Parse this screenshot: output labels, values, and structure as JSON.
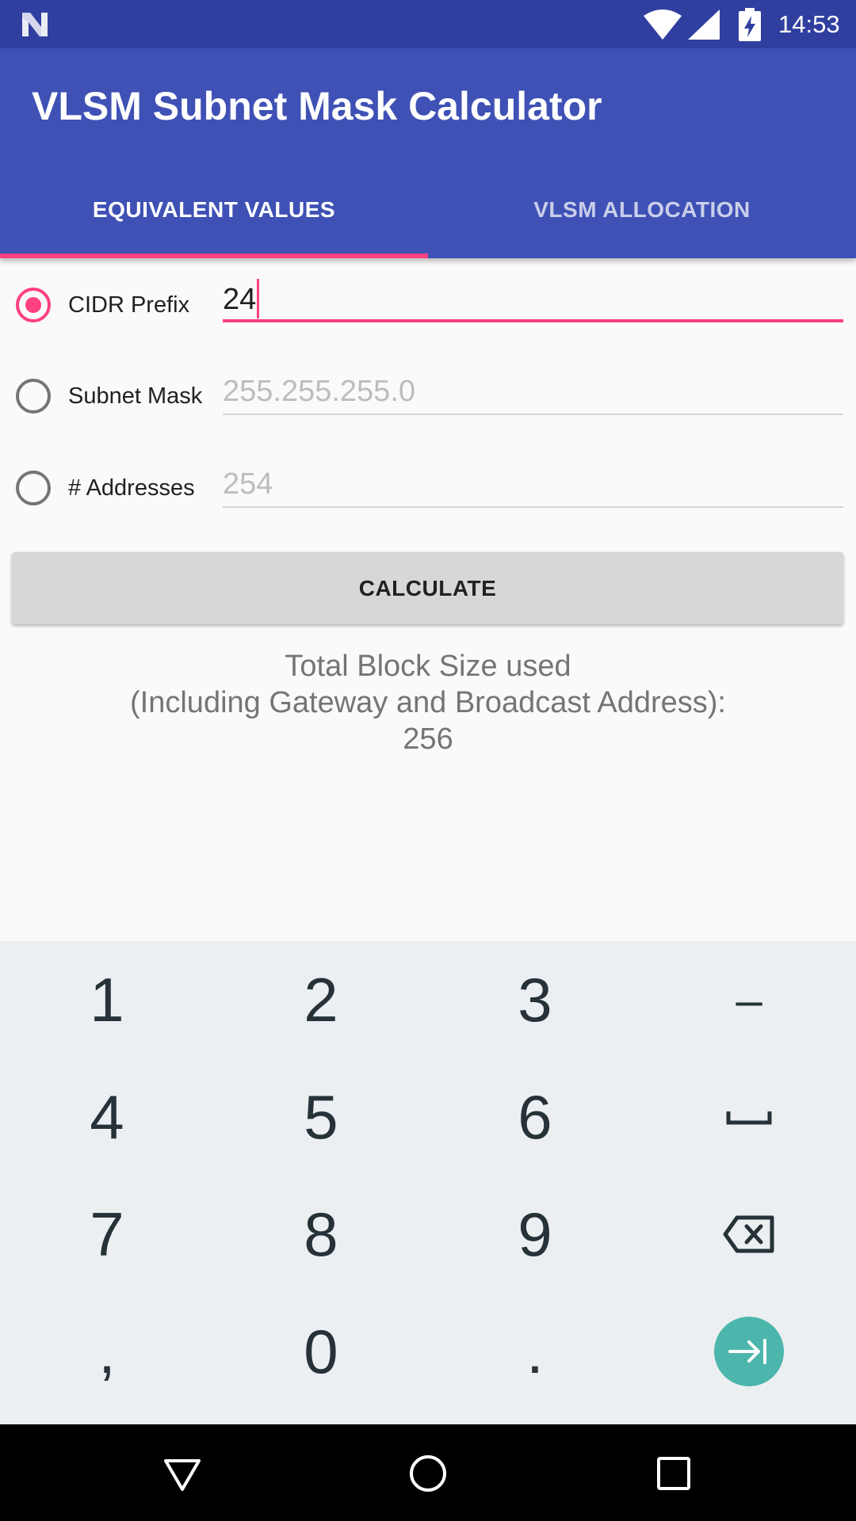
{
  "status_bar": {
    "time": "14:53",
    "icons": [
      "notification-n-icon",
      "wifi-icon",
      "cell-signal-icon",
      "battery-charging-icon"
    ]
  },
  "app_bar": {
    "title": "VLSM Subnet Mask Calculator",
    "color": "#3f51b5"
  },
  "tabs": [
    {
      "label": "EQUIVALENT VALUES",
      "selected": true
    },
    {
      "label": "VLSM ALLOCATION",
      "selected": false
    }
  ],
  "form": {
    "cidr": {
      "label": "CIDR Prefix",
      "value": "24",
      "selected": true
    },
    "mask": {
      "label": "Subnet Mask",
      "placeholder": "255.255.255.0",
      "selected": false
    },
    "addresses": {
      "label": "# Addresses",
      "placeholder": "254",
      "selected": false
    }
  },
  "calculate_label": "CALCULATE",
  "result": {
    "line1": "Total Block Size used",
    "line2": "(Including Gateway and Broadcast Address):",
    "value": "256"
  },
  "keyboard": {
    "rows": [
      [
        "1",
        "2",
        "3",
        "–"
      ],
      [
        "4",
        "5",
        "6",
        "space"
      ],
      [
        "7",
        "8",
        "9",
        "backspace"
      ],
      [
        ",",
        "0",
        ".",
        "next"
      ]
    ],
    "keys": {
      "k1": "1",
      "k2": "2",
      "k3": "3",
      "minus": "–",
      "k4": "4",
      "k5": "5",
      "k6": "6",
      "k7": "7",
      "k8": "8",
      "k9": "9",
      "comma": ",",
      "k0": "0",
      "period": "."
    },
    "accent": "#4db6ac"
  },
  "colors": {
    "primary_dark": "#303f9f",
    "primary": "#3f51b5",
    "accent": "#ff4081"
  }
}
